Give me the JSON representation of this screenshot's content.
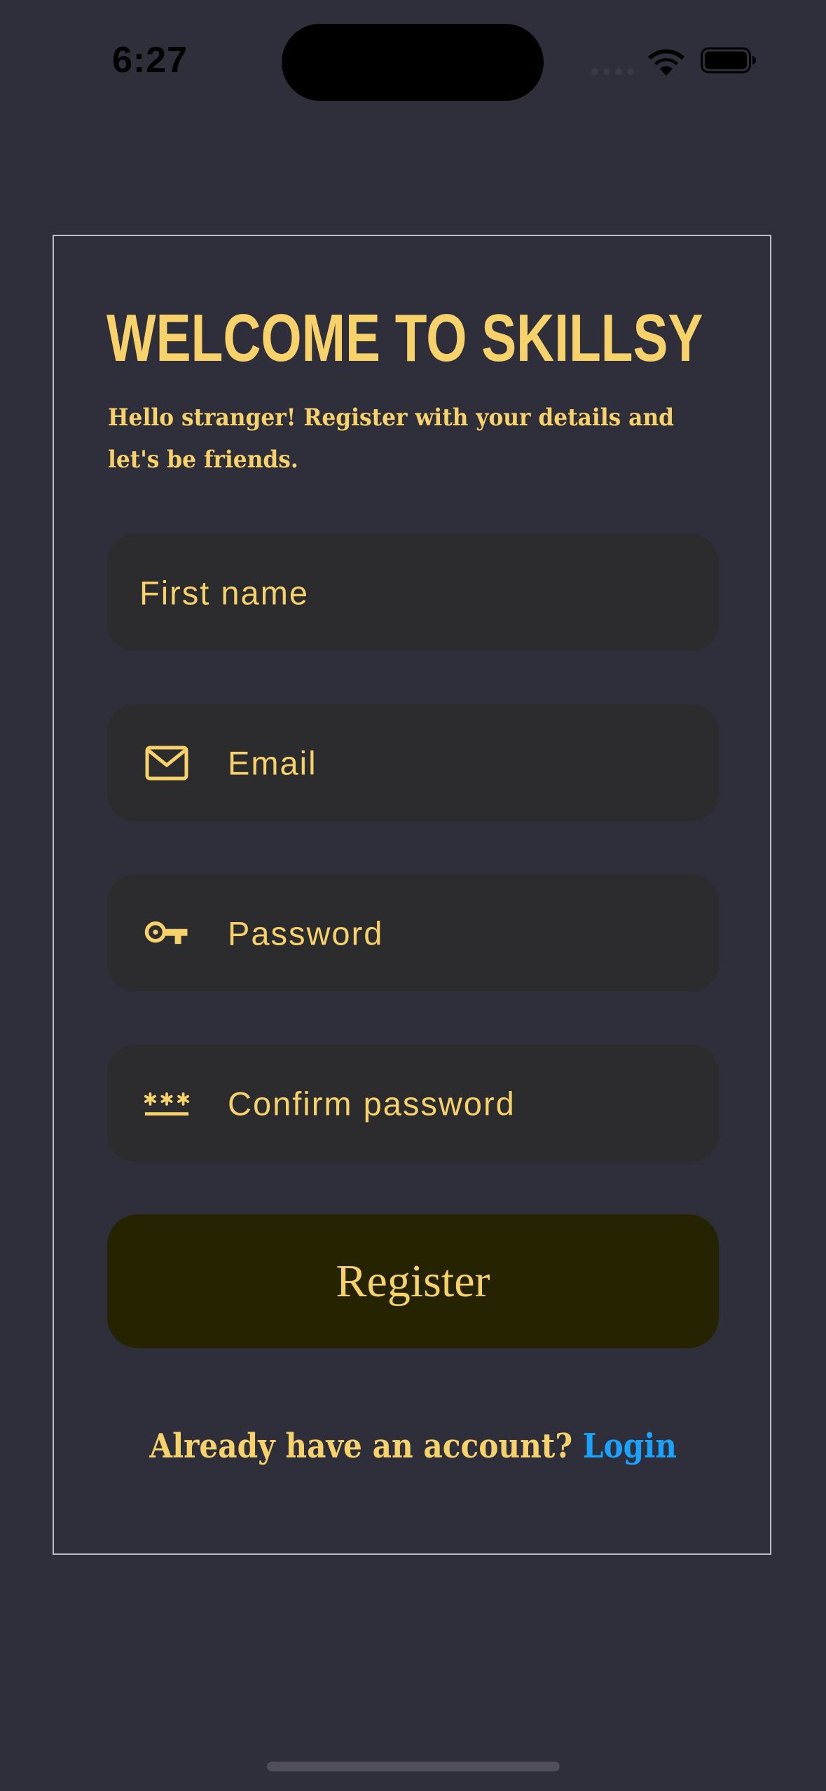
{
  "status_bar": {
    "time": "6:27"
  },
  "screen": {
    "title": "WELCOME TO SKILLSY",
    "subtitle": "Hello stranger!  Register with your details and let's be friends."
  },
  "form": {
    "first_name": {
      "placeholder": "First name"
    },
    "email": {
      "placeholder": "Email",
      "icon": "mail-icon"
    },
    "password": {
      "placeholder": "Password",
      "icon": "key-icon"
    },
    "confirm_password": {
      "placeholder": "Confirm password",
      "icon": "password-dots-icon"
    },
    "register_label": "Register"
  },
  "footer": {
    "prompt": "Already have an account?",
    "login_label": "Login"
  },
  "colors": {
    "background": "#2f2e3b",
    "accent": "#f7d26a",
    "field_bg": "#2c2c2e",
    "button_bg": "#252300",
    "link": "#19a3ff"
  }
}
